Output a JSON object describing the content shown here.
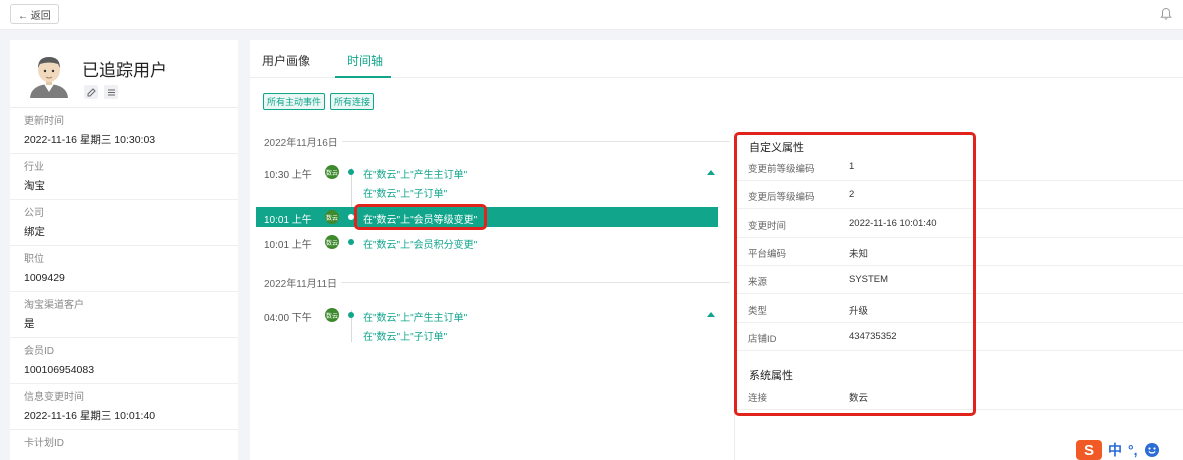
{
  "topbar": {
    "back_label": "← 返回",
    "bell_icon": "bell-icon"
  },
  "profile": {
    "title": "已追踪用户",
    "fields": [
      {
        "label": "更新时间",
        "value": "2022-11-16 星期三 10:30:03"
      },
      {
        "label": "行业",
        "value": "淘宝"
      },
      {
        "label": "公司",
        "value": "绑定"
      },
      {
        "label": "职位",
        "value": "1009429"
      },
      {
        "label": "淘宝渠道客户",
        "value": "是"
      },
      {
        "label": "会员ID",
        "value": "100106954083"
      },
      {
        "label": "信息变更时间",
        "value": "2022-11-16 星期三 10:01:40"
      },
      {
        "label": "卡计划ID",
        "value": ""
      }
    ]
  },
  "tabs": {
    "portrait": "用户画像",
    "timeline": "时间轴",
    "active": "时间轴"
  },
  "filters": {
    "events": "所有主动事件",
    "connections": "所有连接"
  },
  "timeline": {
    "groups": [
      {
        "date": "2022年11月16日",
        "entries": [
          {
            "time": "10:30 上午",
            "badge": "数云",
            "event": "在\"数云\"上\"产生主订单\"",
            "sub_event": "在\"数云\"上\"子订单\""
          },
          {
            "time": "10:01 上午",
            "badge": "数云",
            "event": "在\"数云\"上\"会员等级变更\"",
            "selected": true
          },
          {
            "time": "10:01 上午",
            "badge": "数云",
            "event": "在\"数云\"上\"会员积分变更\""
          }
        ]
      },
      {
        "date": "2022年11月11日",
        "entries": [
          {
            "time": "04:00 下午",
            "badge": "数云",
            "event": "在\"数云\"上\"产生主订单\"",
            "sub_event": "在\"数云\"上\"子订单\""
          }
        ]
      }
    ]
  },
  "detail": {
    "custom_title": "自定义属性",
    "custom_rows": [
      {
        "label": "变更前等级编码",
        "value": "1"
      },
      {
        "label": "变更后等级编码",
        "value": "2"
      },
      {
        "label": "变更时间",
        "value": "2022-11-16 10:01:40"
      },
      {
        "label": "平台编码",
        "value": "未知"
      },
      {
        "label": "来源",
        "value": "SYSTEM"
      },
      {
        "label": "类型",
        "value": "升级"
      },
      {
        "label": "店铺ID",
        "value": "434735352"
      }
    ],
    "system_title": "系统属性",
    "system_rows": [
      {
        "label": "连接",
        "value": "数云"
      }
    ]
  },
  "ime": {
    "logo": "S",
    "lang": "中",
    "punct": "°,",
    "emoji_icon": "smile-icon"
  },
  "colors": {
    "accent": "#11a58c",
    "highlight": "#e0231b",
    "badge": "#3f8a2e"
  }
}
